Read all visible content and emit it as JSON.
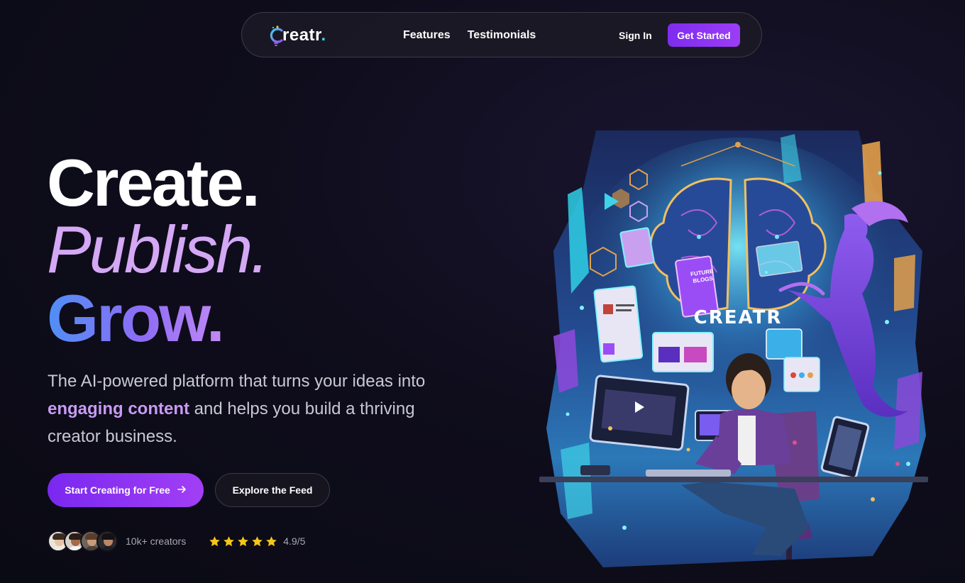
{
  "nav": {
    "logo_text": "reatr",
    "logo_dot": ".",
    "links": [
      "Features",
      "Testimonials"
    ],
    "sign_in": "Sign In",
    "cta": "Get Started"
  },
  "hero": {
    "line1": "Create.",
    "line2": "Publish.",
    "line3": "Grow.",
    "subtitle_pre": "The AI-powered platform that turns your ideas into ",
    "subtitle_highlight": "engaging content",
    "subtitle_post": " and helps you build a thriving creator business.",
    "primary_button": "Start Creating for Free",
    "secondary_button": "Explore the Feed"
  },
  "social_proof": {
    "creators": "10k+ creators",
    "rating": "4.9/5",
    "stars": 5
  },
  "illustration": {
    "brand_text": "CREATR",
    "panel_text_1": "FUTURE",
    "panel_text_2": "BLOGS"
  },
  "colors": {
    "accent": "#8b34f3",
    "publish": "#d4a8f5",
    "highlight": "#c89af5",
    "star": "#f5c518"
  }
}
